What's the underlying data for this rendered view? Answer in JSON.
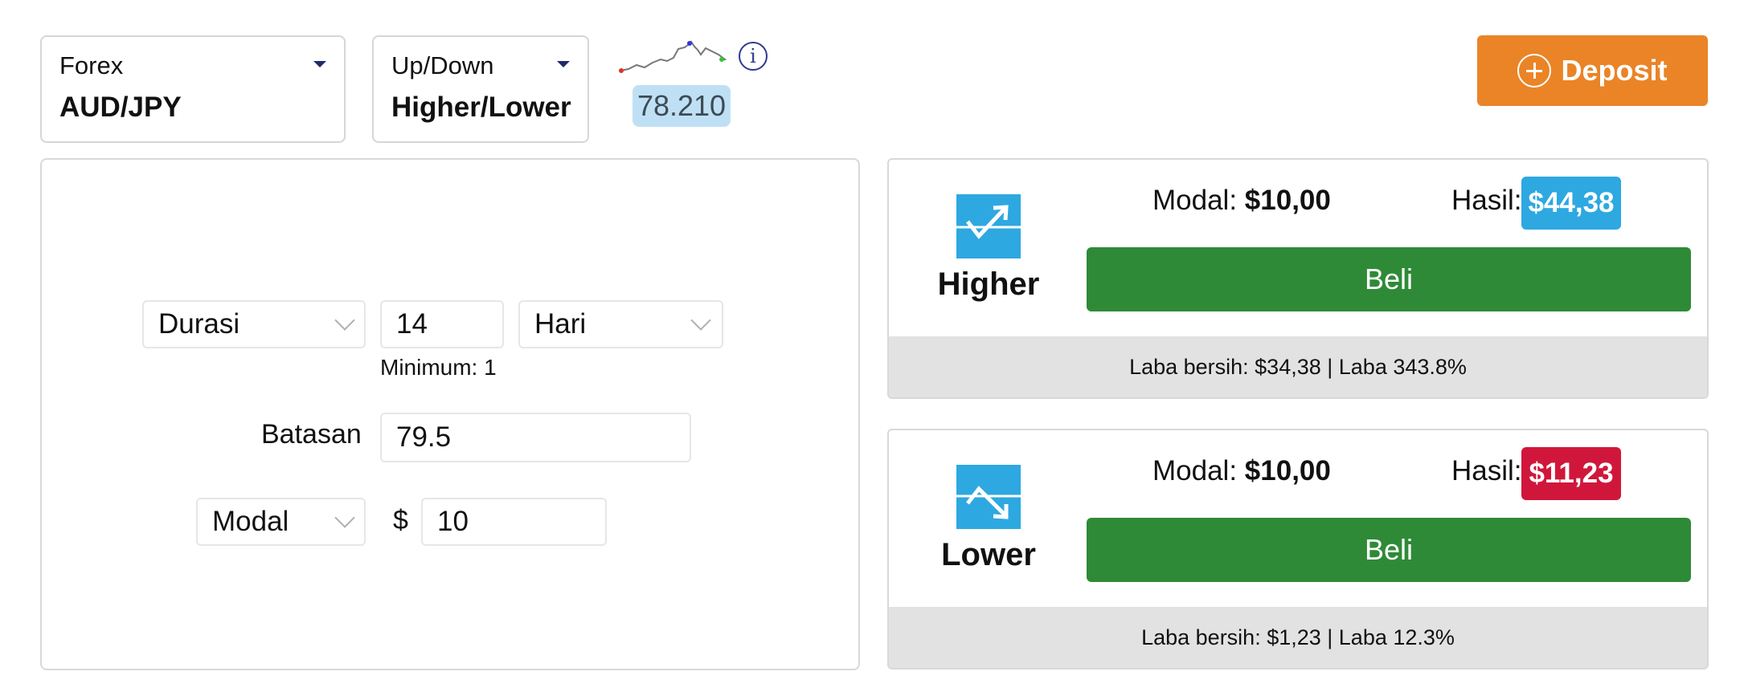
{
  "asset_selector": {
    "category": "Forex",
    "value": "AUD/JPY"
  },
  "type_selector": {
    "category": "Up/Down",
    "value": "Higher/Lower"
  },
  "price": {
    "current": "78.210"
  },
  "deposit": {
    "label": "Deposit"
  },
  "form": {
    "duration_select": "Durasi",
    "duration_value": "14",
    "duration_unit": "Hari",
    "minimum_label": "Minimum: 1",
    "barrier_label": "Batasan",
    "barrier_value": "79.5",
    "stake_select": "Modal",
    "currency_symbol": "$",
    "stake_value": "10"
  },
  "higher": {
    "name": "Higher",
    "modal_label": "Modal:",
    "modal_value": "$10,00",
    "hasil_label": "Hasil:",
    "hasil_value": "$44,38",
    "buy_label": "Beli",
    "footer": "Laba bersih: $34,38 | Laba 343.8%",
    "badge_color": "#2ea8e0"
  },
  "lower": {
    "name": "Lower",
    "modal_label": "Modal:",
    "modal_value": "$10,00",
    "hasil_label": "Hasil:",
    "hasil_value": "$11,23",
    "buy_label": "Beli",
    "footer": "Laba bersih: $1,23 | Laba 12.3%",
    "badge_color": "#d0173b"
  },
  "colors": {
    "buy_green": "#2f8a37",
    "deposit_orange": "#ea8427",
    "icon_blue": "#2ea8e0"
  },
  "icons": [
    "chevron-down-icon",
    "info-icon",
    "plus-circle-icon",
    "trend-up-icon",
    "trend-down-icon"
  ]
}
